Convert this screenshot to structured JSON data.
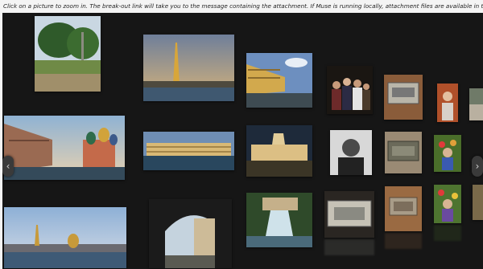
{
  "instructions": "Click on a picture to zoom in. The break-out link will take you to the message containing the attachment. If Muse is running locally, attachment files are available in the directory <HOME>/.muse/user/data",
  "nav": {
    "prev_icon": "‹",
    "next_icon": "›"
  },
  "colors": {
    "page_bg": "#f4f4f4",
    "gallery_bg": "#161616"
  },
  "thumbnails": [
    {
      "name": "photo-trees-park",
      "subject": "trees and lawn"
    },
    {
      "name": "photo-spire-river",
      "subject": "golden spire over river"
    },
    {
      "name": "photo-yellow-buildings-canal",
      "subject": "canal with yellow buildings"
    },
    {
      "name": "photo-group-people",
      "subject": "group of people"
    },
    {
      "name": "photo-metal-plaque-1",
      "subject": "metal plaque"
    },
    {
      "name": "photo-person-orange",
      "subject": "person"
    },
    {
      "name": "photo-church-domes",
      "subject": "church with onion domes"
    },
    {
      "name": "photo-palace-waterfront",
      "subject": "palace waterfront"
    },
    {
      "name": "photo-museum-evening",
      "subject": "museum at evening"
    },
    {
      "name": "photo-man-portrait",
      "subject": "man portrait"
    },
    {
      "name": "photo-metal-plaque-2",
      "subject": "metal plaque"
    },
    {
      "name": "photo-child-flowers-1",
      "subject": "child with flowers"
    },
    {
      "name": "photo-city-skyline",
      "subject": "city skyline"
    },
    {
      "name": "photo-arch-street",
      "subject": "street through arch"
    },
    {
      "name": "photo-fountain",
      "subject": "fountain cascade"
    },
    {
      "name": "photo-metal-plaque-3",
      "subject": "metal plaque"
    },
    {
      "name": "photo-metal-plaque-4",
      "subject": "metal plaque"
    },
    {
      "name": "photo-child-flowers-2",
      "subject": "child with flowers"
    }
  ]
}
